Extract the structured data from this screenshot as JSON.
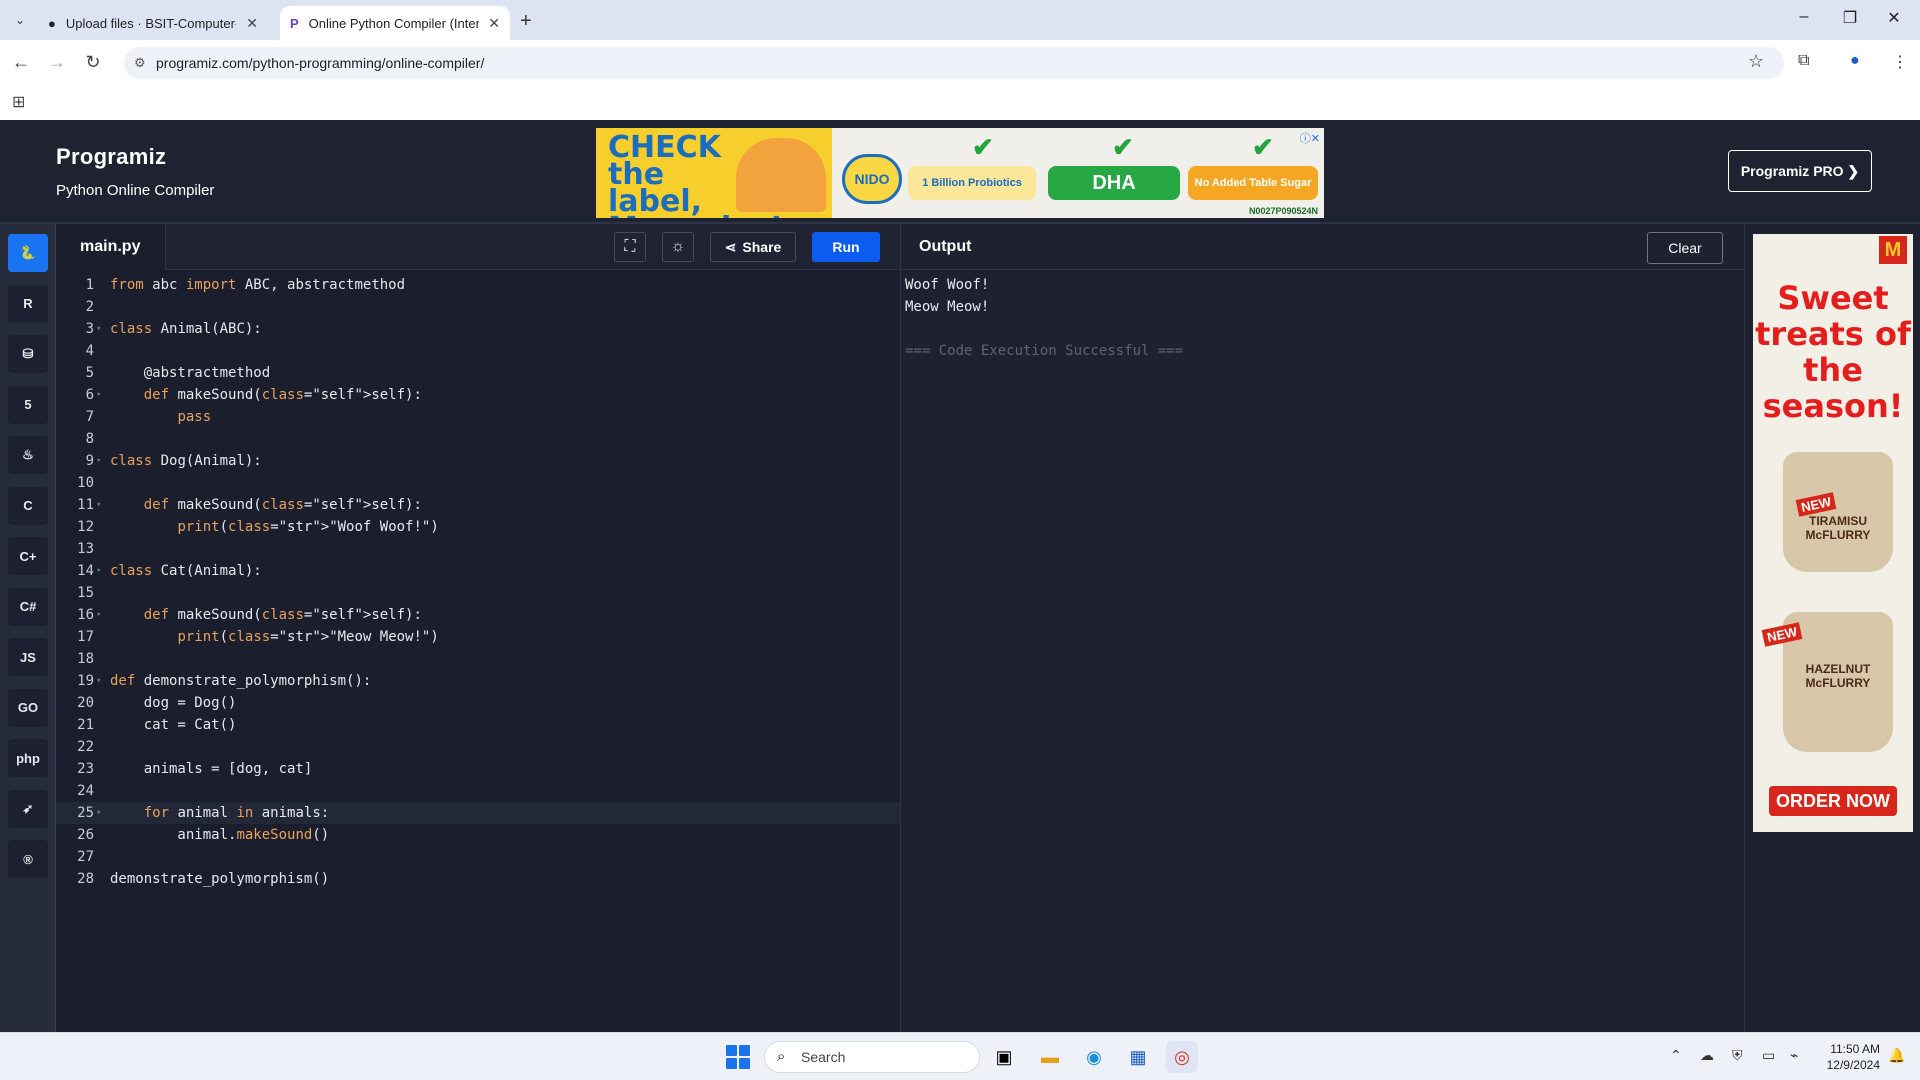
{
  "browser": {
    "tabs": [
      {
        "title": "Upload files · BSIT-Computer-P",
        "active": false
      },
      {
        "title": "Online Python Compiler (Interp",
        "active": true
      }
    ],
    "url": "programiz.com/python-programming/online-compiler/"
  },
  "site": {
    "logo": "Programiz",
    "subtitle": "Python Online Compiler",
    "pro_button": "Programiz PRO ❯"
  },
  "ad_banner": {
    "headline": "CHECK the label, Mommies!",
    "brand": "NIDO",
    "pill1": "1 Billion Probiotics",
    "pill2": "DHA",
    "pill3": "No Added Table Sugar",
    "code": "N0027P090524N"
  },
  "sidebar": {
    "languages": [
      {
        "name": "python-icon",
        "glyph": "🐍",
        "active": true
      },
      {
        "name": "r-icon",
        "glyph": "R",
        "active": false
      },
      {
        "name": "sql-icon",
        "glyph": "⛁",
        "active": false
      },
      {
        "name": "html-icon",
        "glyph": "5",
        "active": false
      },
      {
        "name": "java-icon",
        "glyph": "♨",
        "active": false
      },
      {
        "name": "c-icon",
        "glyph": "C",
        "active": false
      },
      {
        "name": "cpp-icon",
        "glyph": "C+",
        "active": false
      },
      {
        "name": "csharp-icon",
        "glyph": "C#",
        "active": false
      },
      {
        "name": "javascript-icon",
        "glyph": "JS",
        "active": false
      },
      {
        "name": "go-icon",
        "glyph": "GO",
        "active": false
      },
      {
        "name": "php-icon",
        "glyph": "php",
        "active": false
      },
      {
        "name": "swift-icon",
        "glyph": "➶",
        "active": false
      },
      {
        "name": "rust-icon",
        "glyph": "®",
        "active": false
      }
    ]
  },
  "editor": {
    "filename": "main.py",
    "share_label": "Share",
    "run_label": "Run",
    "lines": [
      "from abc import ABC, abstractmethod",
      "",
      "class Animal(ABC):",
      "",
      "    @abstractmethod",
      "    def makeSound(self):",
      "        pass",
      "",
      "class Dog(Animal):",
      "",
      "    def makeSound(self):",
      "        print(\"Woof Woof!\")",
      "",
      "class Cat(Animal):",
      "",
      "    def makeSound(self):",
      "        print(\"Meow Meow!\")",
      "",
      "def demonstrate_polymorphism():",
      "    dog = Dog()",
      "    cat = Cat()",
      "",
      "    animals = [dog, cat]",
      "",
      "    for animal in animals:",
      "        animal.makeSound()",
      "",
      "demonstrate_polymorphism()"
    ],
    "fold_lines": [
      3,
      6,
      9,
      11,
      14,
      16,
      19,
      25
    ],
    "highlight_line": 25
  },
  "output": {
    "title": "Output",
    "clear_label": "Clear",
    "lines": [
      "Woof Woof!",
      "Meow Meow!",
      "",
      "=== Code Execution Successful ==="
    ]
  },
  "side_ad": {
    "headline": "Sweet treats of the season!",
    "item1": "TIRAMISU McFLURRY",
    "item2": "HAZELNUT McFLURRY",
    "new_tag": "NEW",
    "cta": "ORDER NOW"
  },
  "taskbar": {
    "search_placeholder": "Search",
    "time": "11:50 AM",
    "date": "12/9/2024"
  }
}
